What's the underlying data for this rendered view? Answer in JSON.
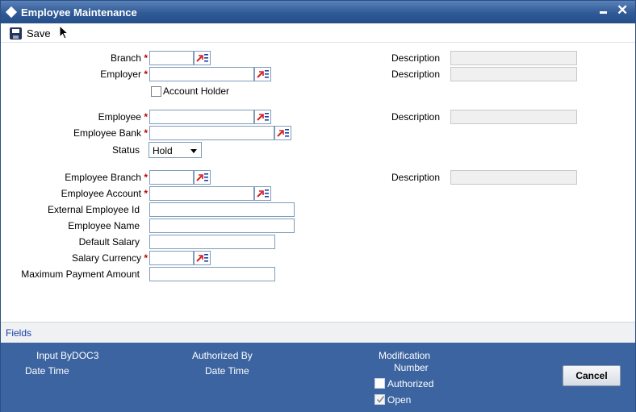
{
  "window": {
    "title": "Employee Maintenance"
  },
  "toolbar": {
    "save_label": "Save"
  },
  "form": {
    "branch_label": "Branch",
    "employer_label": "Employer",
    "account_holder_label": "Account Holder",
    "employee_label": "Employee",
    "employee_bank_label": "Employee Bank",
    "status_label": "Status",
    "status_value": "Hold",
    "employee_branch_label": "Employee Branch",
    "employee_account_label": "Employee Account",
    "external_employee_id_label": "External Employee Id",
    "employee_name_label": "Employee Name",
    "default_salary_label": "Default Salary",
    "salary_currency_label": "Salary Currency",
    "max_payment_label": "Maximum Payment Amount",
    "required_marker": "*",
    "description_label": "Description"
  },
  "fields_link": "Fields",
  "footer": {
    "input_by": "Input ByDOC3",
    "date_time": "Date Time",
    "authorized_by": "Authorized By",
    "date_time_2": "Date Time",
    "modification": "Modification",
    "number": "Number",
    "authorized": "Authorized",
    "open": "Open",
    "cancel": "Cancel"
  },
  "colors": {
    "titlebar": "#2f5a96",
    "footer": "#3c64a0",
    "required": "#c00000",
    "link": "#1a3ea8"
  }
}
